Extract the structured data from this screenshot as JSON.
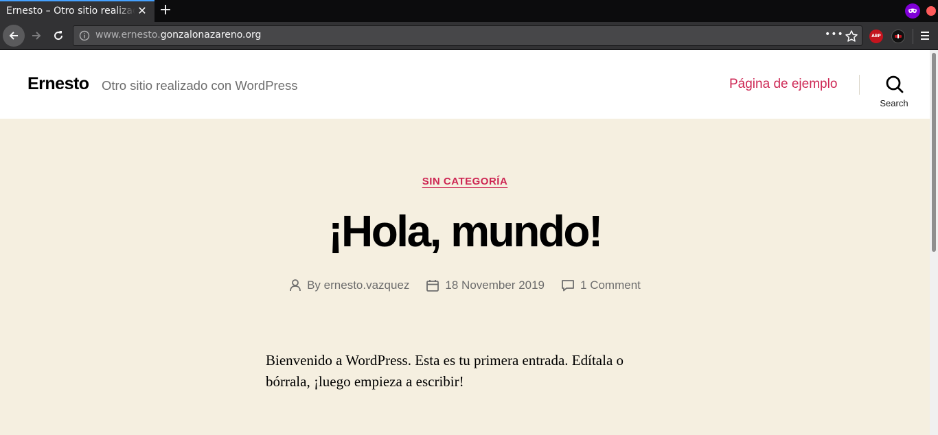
{
  "browser": {
    "tab_title": "Ernesto – Otro sitio realizado con WordPress",
    "url_prefix": "www.ernesto.",
    "url_domain": "gonzalonazareno.org",
    "adblock_label": "ABP",
    "page_actions_label": "•••"
  },
  "site": {
    "title": "Ernesto",
    "description": "Otro sitio realizado con WordPress",
    "menu": [
      "Página de ejemplo"
    ],
    "search_label": "Search",
    "accent_color": "#cd2653",
    "background_color": "#f5efe0"
  },
  "post": {
    "category": "SIN CATEGORÍA",
    "title": "¡Hola, mundo!",
    "author_prefix": "By",
    "author": "ernesto.vazquez",
    "date": "18 November 2019",
    "comments": "1 Comment",
    "content": "Bienvenido a WordPress. Esta es tu primera entrada. Edítala o bórrala, ¡luego empieza a escribir!"
  }
}
